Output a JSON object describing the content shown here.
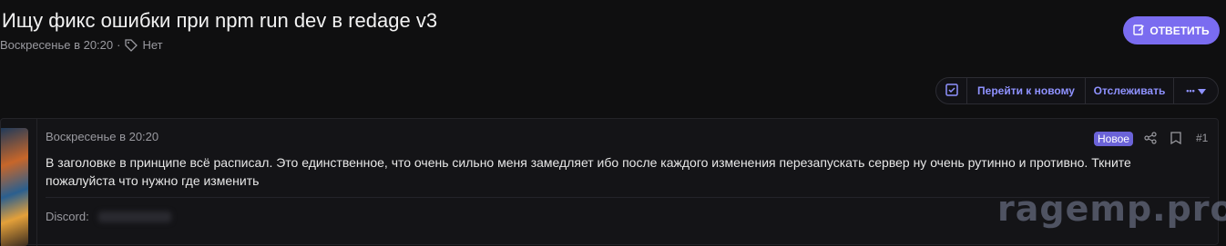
{
  "thread": {
    "title": "Ищу фикс ошибки при npm run dev в redage v3",
    "date": "Воскресенье в 20:20",
    "dot": "·",
    "tag": "Нет"
  },
  "reply_button": {
    "label": "ОТВЕТИТЬ"
  },
  "toolbar": {
    "go_new": "Перейти к новому",
    "watch": "Отслеживать",
    "more": "•••"
  },
  "post": {
    "date": "Воскресенье в 20:20",
    "badge": "Новое",
    "number": "#1",
    "body": "В заголовке в принципе всё расписал. Это единственное, что очень сильно меня замедляет ибо после каждого изменения перезапускать сервер ну очень рутинно и противно. Ткните пожалуйста что нужно где изменить",
    "signature_label": "Discord:"
  },
  "watermark": "ragemp.pro",
  "colors": {
    "accent": "#7a6cf0",
    "link": "#8f92ff",
    "bg": "#0f0f10"
  }
}
